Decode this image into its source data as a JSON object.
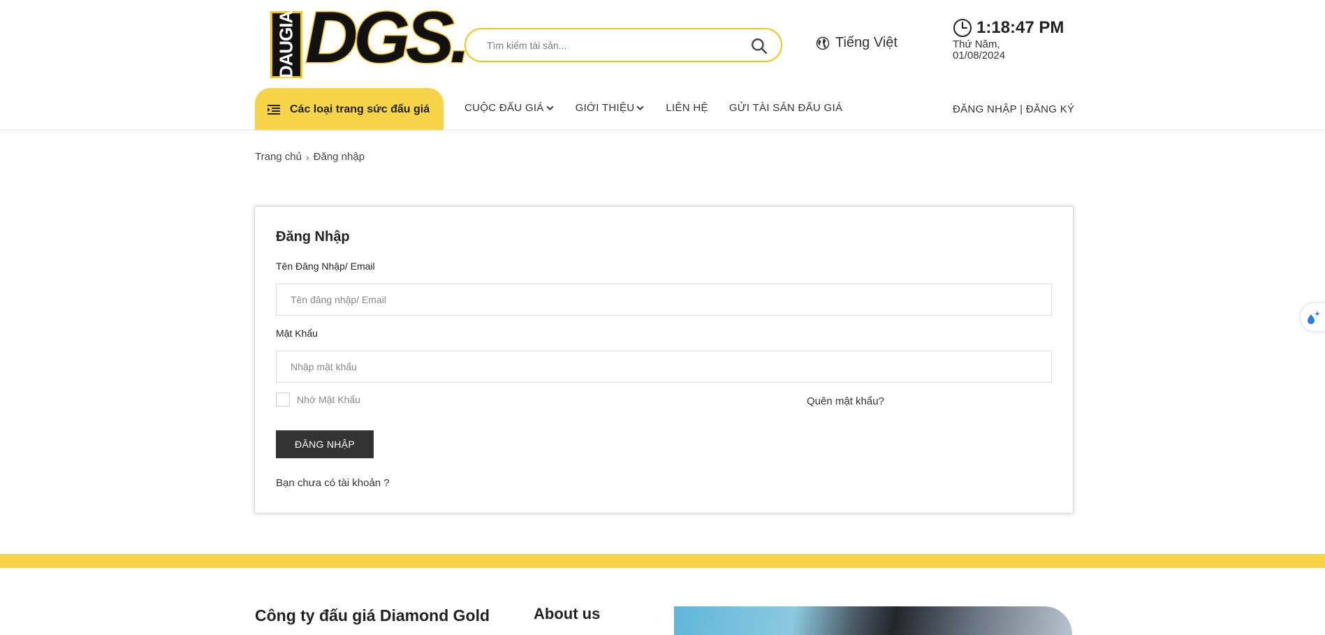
{
  "header": {
    "logo_side_text": "DAUGIA",
    "logo_main_text": "DGS.",
    "search_placeholder": "Tìm kiếm tài sản...",
    "language": "Tiếng Việt",
    "time": "1:18:47 PM",
    "date": "Thứ Năm, 01/08/2024"
  },
  "nav": {
    "category_button": "Các loại trang sức đấu giá",
    "items": [
      {
        "label": "CUỘC ĐẤU GIÁ",
        "has_dropdown": true
      },
      {
        "label": "GIỚI THIỆU",
        "has_dropdown": true
      },
      {
        "label": "LIÊN HỆ",
        "has_dropdown": false
      },
      {
        "label": "GỬI TÀI SẢN ĐẤU GIÁ",
        "has_dropdown": false
      }
    ],
    "auth": "ĐĂNG NHẬP | ĐĂNG KÝ"
  },
  "breadcrumb": {
    "home": "Trang chủ",
    "separator": "›",
    "current": "Đăng nhập"
  },
  "login": {
    "title": "Đăng Nhập",
    "username_label": "Tên Đăng Nhập/ Email",
    "username_placeholder": "Tên đăng nhập/ Email",
    "password_label": "Mật Khẩu",
    "password_placeholder": "Nhập mật khẩu",
    "remember_label": "Nhớ Mật Khẩu",
    "remember_checked": false,
    "forgot_label": "Quên mật khẩu?",
    "submit_label": "ĐĂNG NHẬP",
    "no_account_label": "Bạn chưa có tài khoản ?"
  },
  "footer": {
    "company": "Công ty đấu giá Diamond Gold",
    "about": "About us"
  },
  "colors": {
    "accent_yellow": "#f7d447",
    "logo_yellow": "#f5c518",
    "button_dark": "#333333"
  },
  "icons": {
    "search": "search-icon",
    "language": "globe-icon",
    "clock": "clock-icon",
    "category": "menu-icon",
    "dropdown": "chevron-down-icon",
    "widget": "sparkle-drop-icon"
  }
}
